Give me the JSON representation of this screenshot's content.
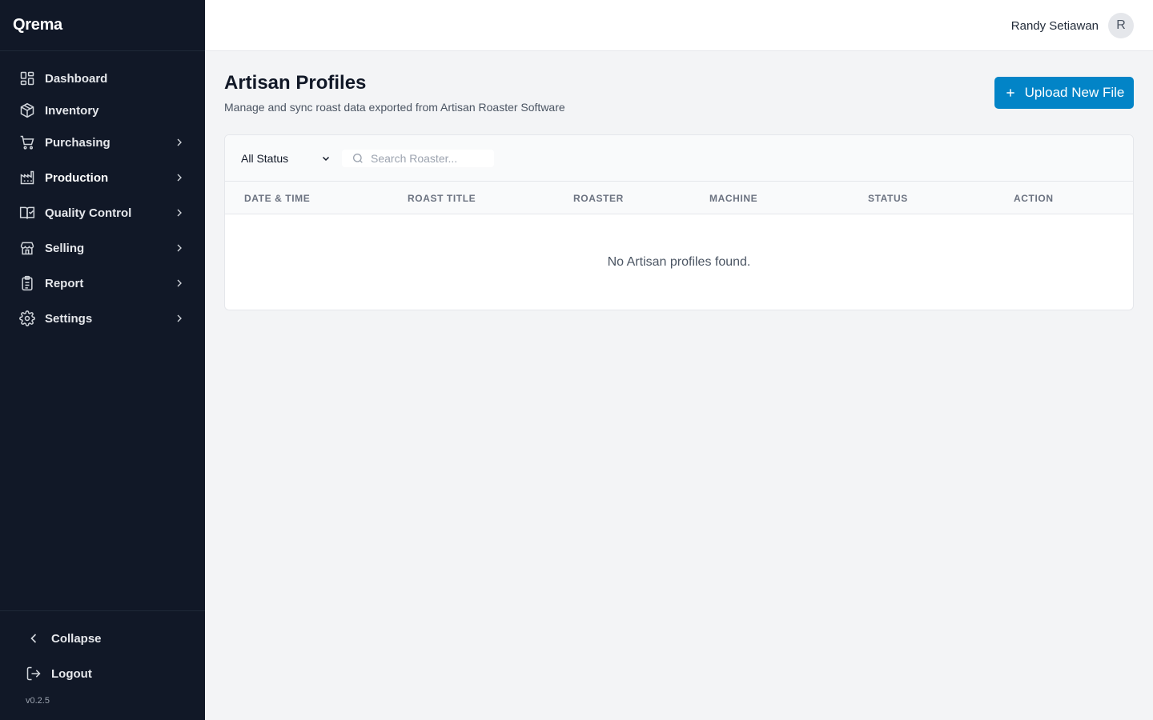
{
  "app": {
    "brand": "Qrema",
    "version": "v0.2.5"
  },
  "sidebar": {
    "items": [
      {
        "label": "Dashboard",
        "icon": "dashboard-icon",
        "has_submenu": false
      },
      {
        "label": "Inventory",
        "icon": "box-icon",
        "has_submenu": false
      },
      {
        "label": "Purchasing",
        "icon": "cart-icon",
        "has_submenu": true
      },
      {
        "label": "Production",
        "icon": "factory-icon",
        "has_submenu": true
      },
      {
        "label": "Quality Control",
        "icon": "book-check-icon",
        "has_submenu": true
      },
      {
        "label": "Selling",
        "icon": "store-icon",
        "has_submenu": true
      },
      {
        "label": "Report",
        "icon": "clipboard-icon",
        "has_submenu": true
      },
      {
        "label": "Settings",
        "icon": "gear-icon",
        "has_submenu": true
      }
    ],
    "collapse_label": "Collapse",
    "logout_label": "Logout"
  },
  "header": {
    "user_name": "Randy Setiawan",
    "avatar_initial": "R"
  },
  "page": {
    "title": "Artisan Profiles",
    "subtitle": "Manage and sync roast data exported from Artisan Roaster Software",
    "upload_label": "Upload New File"
  },
  "filters": {
    "status_value": "All Status",
    "search_placeholder": "Search Roaster..."
  },
  "table": {
    "columns": [
      "DATE & TIME",
      "ROAST TITLE",
      "ROASTER",
      "MACHINE",
      "STATUS",
      "ACTION"
    ],
    "empty_message": "No Artisan profiles found."
  },
  "colors": {
    "sidebar_bg": "#111827",
    "accent": "#0284c7",
    "page_bg": "#f3f4f6"
  }
}
